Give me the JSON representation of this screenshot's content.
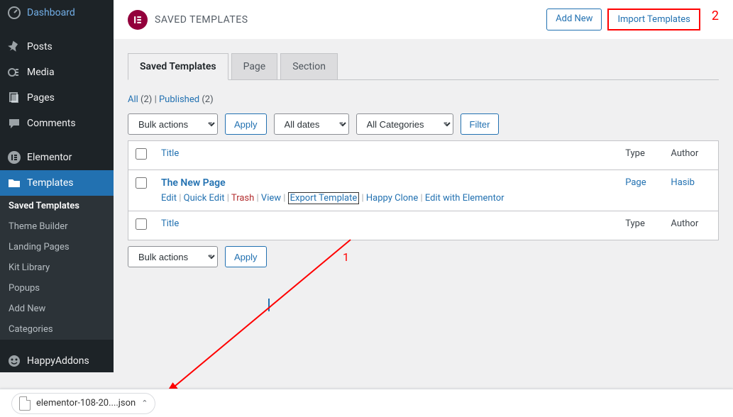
{
  "sidebar": {
    "items": [
      {
        "name": "dashboard",
        "label": "Dashboard"
      },
      {
        "name": "posts",
        "label": "Posts"
      },
      {
        "name": "media",
        "label": "Media"
      },
      {
        "name": "pages",
        "label": "Pages"
      },
      {
        "name": "comments",
        "label": "Comments"
      },
      {
        "name": "elementor",
        "label": "Elementor"
      },
      {
        "name": "templates",
        "label": "Templates"
      },
      {
        "name": "happyaddons",
        "label": "HappyAddons"
      }
    ],
    "templates_sub": [
      {
        "label": "Saved Templates",
        "current": true
      },
      {
        "label": "Theme Builder"
      },
      {
        "label": "Landing Pages"
      },
      {
        "label": "Kit Library"
      },
      {
        "label": "Popups"
      },
      {
        "label": "Add New"
      },
      {
        "label": "Categories"
      }
    ]
  },
  "header": {
    "logo_text": "E",
    "title": "SAVED TEMPLATES",
    "add_new": "Add New",
    "import": "Import Templates",
    "annotation": "2"
  },
  "tabs": [
    {
      "label": "Saved Templates",
      "active": true
    },
    {
      "label": "Page"
    },
    {
      "label": "Section"
    }
  ],
  "subsubsub": {
    "all_label": "All",
    "all_count": "(2)",
    "published_label": "Published",
    "published_count": "(2)",
    "sep": " | "
  },
  "controls": {
    "bulk_actions": "Bulk actions",
    "apply": "Apply",
    "all_dates": "All dates",
    "all_categories": "All Categories",
    "filter": "Filter"
  },
  "table": {
    "headers": {
      "title": "Title",
      "type": "Type",
      "author": "Author"
    },
    "row": {
      "title": "The New Page",
      "type": "Page",
      "author": "Hasib",
      "actions": {
        "edit": "Edit",
        "quick_edit": "Quick Edit",
        "trash": "Trash",
        "view": "View",
        "export": "Export Template",
        "happy_clone": "Happy Clone",
        "edit_elementor": "Edit with Elementor"
      }
    }
  },
  "annotations": {
    "one": "1"
  },
  "download": {
    "filename": "elementor-108-20....json"
  }
}
